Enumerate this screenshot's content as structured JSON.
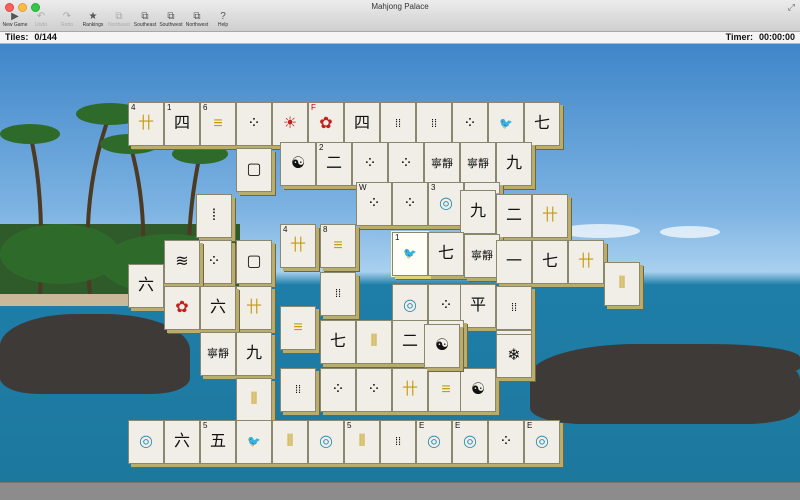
{
  "window": {
    "title": "Mahjong Palace"
  },
  "toolbar": {
    "items": [
      {
        "label": "New Game",
        "icon": "play-icon",
        "glyph": "▶",
        "enabled": true
      },
      {
        "label": "Undo",
        "icon": "undo-icon",
        "glyph": "↶",
        "enabled": false
      },
      {
        "label": "Redo",
        "icon": "redo-icon",
        "glyph": "↷",
        "enabled": false
      },
      {
        "label": "Rankings",
        "icon": "star-icon",
        "glyph": "★",
        "enabled": true
      },
      {
        "label": "Northeast",
        "icon": "view-northeast-icon",
        "glyph": "⧉",
        "enabled": false
      },
      {
        "label": "Southeast",
        "icon": "view-southeast-icon",
        "glyph": "⧉",
        "enabled": true
      },
      {
        "label": "Southwest",
        "icon": "view-southwest-icon",
        "glyph": "⧉",
        "enabled": true
      },
      {
        "label": "Northwest",
        "icon": "view-northwest-icon",
        "glyph": "⧉",
        "enabled": true
      },
      {
        "label": "Help",
        "icon": "help-icon",
        "glyph": "?",
        "enabled": true
      }
    ]
  },
  "status": {
    "tiles_label": "Tiles:",
    "tiles_value": "0/144",
    "timer_label": "Timer:",
    "timer_value": "00:00:00"
  },
  "tiles": [
    {
      "num": "4",
      "sym": "卄"
    },
    {
      "num": "1",
      "sym": "四"
    },
    {
      "num": "6",
      "sym": "≡"
    },
    {
      "num": "",
      "sym": "⁘"
    },
    {
      "num": "",
      "sym": "☀"
    },
    {
      "num": "F",
      "sym": "✿",
      "numColor": "red"
    },
    {
      "num": "",
      "sym": "四"
    },
    {
      "num": "",
      "sym": "⁞⁞"
    },
    {
      "num": "",
      "sym": "⁞⁞"
    },
    {
      "num": "",
      "sym": "⁘"
    },
    {
      "num": "",
      "sym": "🐦"
    },
    {
      "num": "",
      "sym": "七"
    },
    {
      "num": "",
      "sym": "▢"
    },
    {
      "num": "",
      "sym": "☯"
    },
    {
      "num": "2",
      "sym": "二"
    },
    {
      "num": "",
      "sym": "⁘"
    },
    {
      "num": "",
      "sym": "⁘"
    },
    {
      "num": "",
      "sym": "寧靜"
    },
    {
      "num": "",
      "sym": "寧靜"
    },
    {
      "num": "",
      "sym": "九"
    },
    {
      "num": "",
      "sym": "⁞"
    },
    {
      "num": "W",
      "sym": "⁘"
    },
    {
      "num": "",
      "sym": "⁘"
    },
    {
      "num": "3",
      "sym": "◎"
    },
    {
      "num": "",
      "sym": "◎"
    },
    {
      "num": "",
      "sym": "九"
    },
    {
      "num": "",
      "sym": "二"
    },
    {
      "num": "",
      "sym": "卄"
    },
    {
      "num": "",
      "sym": "⁘"
    },
    {
      "num": "",
      "sym": "⦀"
    },
    {
      "num": "",
      "sym": "▢"
    },
    {
      "num": "4",
      "sym": "卄"
    },
    {
      "num": "8",
      "sym": "≡"
    },
    {
      "num": "1",
      "sym": "🐦"
    },
    {
      "num": "",
      "sym": "七"
    },
    {
      "num": "",
      "sym": "寧靜"
    },
    {
      "num": "",
      "sym": "一"
    },
    {
      "num": "",
      "sym": "七"
    },
    {
      "num": "",
      "sym": "卄"
    },
    {
      "num": "",
      "sym": "六"
    },
    {
      "num": "",
      "sym": "≋"
    },
    {
      "num": "",
      "sym": "☯"
    },
    {
      "num": "",
      "sym": "卄"
    },
    {
      "num": "",
      "sym": "⁞⁞"
    },
    {
      "num": "",
      "sym": "◎"
    },
    {
      "num": "",
      "sym": "⁘"
    },
    {
      "num": "",
      "sym": "平"
    },
    {
      "num": "",
      "sym": "⁞⁞"
    },
    {
      "num": "",
      "sym": "⦀"
    },
    {
      "num": "",
      "sym": "✿"
    },
    {
      "num": "",
      "sym": "六"
    },
    {
      "num": "",
      "sym": "≡"
    },
    {
      "num": "",
      "sym": "七"
    },
    {
      "num": "",
      "sym": "⦀"
    },
    {
      "num": "",
      "sym": "二"
    },
    {
      "num": "",
      "sym": "⁘"
    },
    {
      "num": "",
      "sym": "⁘"
    },
    {
      "num": "",
      "sym": "寧靜"
    },
    {
      "num": "",
      "sym": "九"
    },
    {
      "num": "",
      "sym": "⦀"
    },
    {
      "num": "",
      "sym": "⁞⁞"
    },
    {
      "num": "",
      "sym": "⁘"
    },
    {
      "num": "",
      "sym": "⁘"
    },
    {
      "num": "",
      "sym": "卄"
    },
    {
      "num": "",
      "sym": "≡"
    },
    {
      "num": "",
      "sym": "☯"
    },
    {
      "num": "",
      "sym": "❄"
    },
    {
      "num": "",
      "sym": "◎"
    },
    {
      "num": "",
      "sym": "六"
    },
    {
      "num": "5",
      "sym": "五"
    },
    {
      "num": "",
      "sym": "🐦"
    },
    {
      "num": "",
      "sym": "⦀"
    },
    {
      "num": "",
      "sym": "◎"
    },
    {
      "num": "5",
      "sym": "⦀"
    },
    {
      "num": "",
      "sym": "⁞⁞"
    },
    {
      "num": "E",
      "sym": "◎"
    },
    {
      "num": "E",
      "sym": "◎"
    },
    {
      "num": "",
      "sym": "⁘"
    },
    {
      "num": "E",
      "sym": "◎"
    },
    {
      "num": "",
      "sym": "☯"
    }
  ]
}
